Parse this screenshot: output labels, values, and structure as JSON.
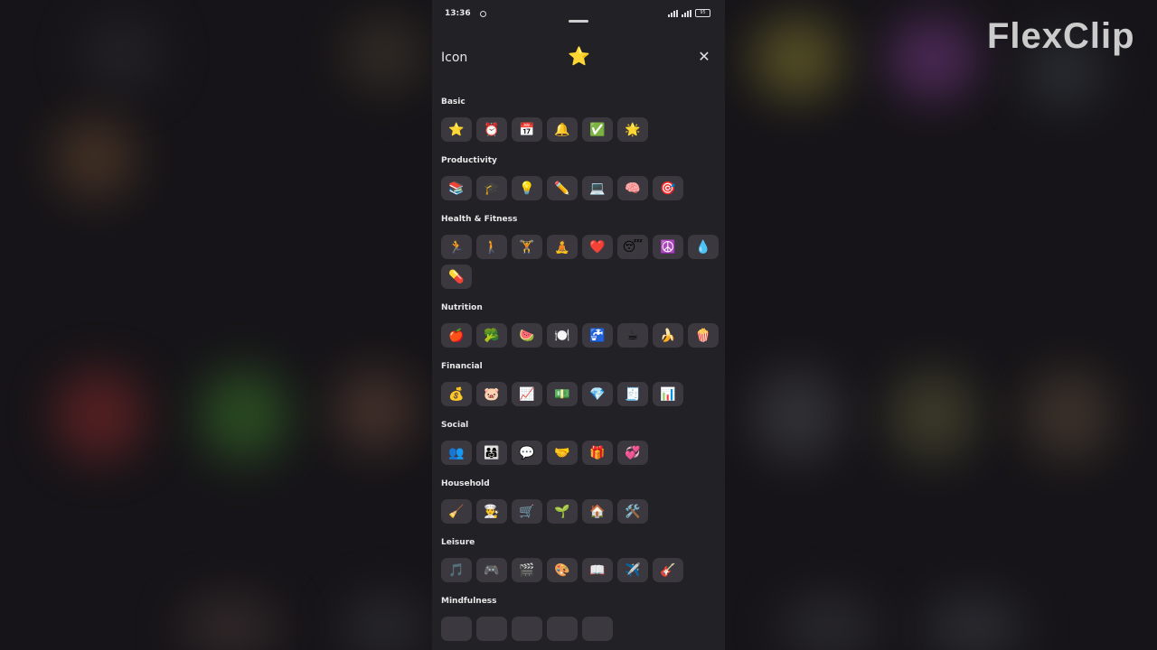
{
  "watermark": "FlexClip",
  "statusbar": {
    "time": "13:36",
    "battery": "95"
  },
  "header": {
    "title": "Icon",
    "selected_icon": "⭐",
    "close_label": "✕"
  },
  "sections": [
    {
      "title": "Basic",
      "icons": [
        "⭐",
        "⏰",
        "📅",
        "🔔",
        "✅",
        "🌟"
      ]
    },
    {
      "title": "Productivity",
      "icons": [
        "📚",
        "🎓",
        "💡",
        "✏️",
        "💻",
        "🧠",
        "🎯"
      ]
    },
    {
      "title": "Health & Fitness",
      "icons": [
        "🏃",
        "🚶",
        "🏋️",
        "🧘",
        "❤️",
        "😴",
        "☮️",
        "💧",
        "💊"
      ]
    },
    {
      "title": "Nutrition",
      "icons": [
        "🍎",
        "🥦",
        "🍉",
        "🍽️",
        "🚰",
        "☕",
        "🍌",
        "🍿"
      ]
    },
    {
      "title": "Financial",
      "icons": [
        "💰",
        "🐷",
        "📈",
        "💵",
        "💎",
        "🧾",
        "📊"
      ]
    },
    {
      "title": "Social",
      "icons": [
        "👥",
        "👨‍👩‍👧",
        "💬",
        "🤝",
        "🎁",
        "💞"
      ]
    },
    {
      "title": "Household",
      "icons": [
        "🧹",
        "👨‍🍳",
        "🛒",
        "🌱",
        "🏠",
        "🛠️"
      ]
    },
    {
      "title": "Leisure",
      "icons": [
        "🎵",
        "🎮",
        "🎬",
        "🎨",
        "📖",
        "✈️",
        "🎸"
      ]
    },
    {
      "title": "Mindfulness",
      "icons": [
        "",
        "",
        "",
        "",
        ""
      ]
    }
  ]
}
